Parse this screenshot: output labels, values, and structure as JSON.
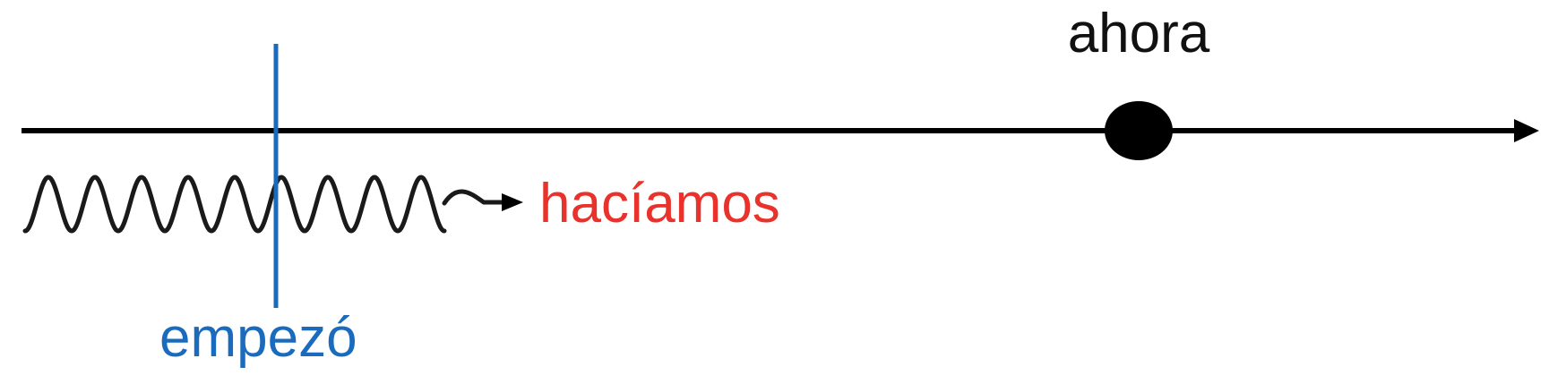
{
  "labels": {
    "now": "ahora",
    "imperfect": "hacíamos",
    "preterite": "empezó"
  },
  "colors": {
    "timeline": "#000000",
    "now_marker": "#000000",
    "imperfect_wave": "#1a1a1a",
    "imperfect_text": "#e8322b",
    "preterite_line": "#1a6bbd",
    "preterite_text": "#1a6bbd"
  }
}
